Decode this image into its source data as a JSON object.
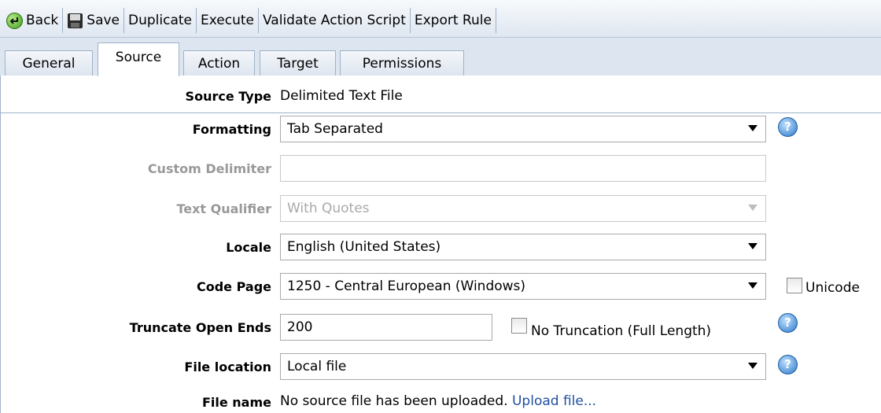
{
  "toolbar": {
    "back": "Back",
    "save": "Save",
    "duplicate": "Duplicate",
    "execute": "Execute",
    "validate": "Validate Action Script",
    "export": "Export Rule"
  },
  "tabs": {
    "general": "General",
    "source": "Source",
    "action": "Action",
    "target": "Target",
    "permissions": "Permissions",
    "active": "Source"
  },
  "form": {
    "source_type": {
      "label": "Source Type",
      "value": "Delimited Text File"
    },
    "formatting": {
      "label": "Formatting",
      "value": "Tab Separated"
    },
    "custom_delimiter": {
      "label": "Custom Delimiter",
      "value": ""
    },
    "text_qualifier": {
      "label": "Text Qualifier",
      "value": "With Quotes"
    },
    "locale": {
      "label": "Locale",
      "value": "English (United States)"
    },
    "code_page": {
      "label": "Code Page",
      "value": "1250 - Central European (Windows)",
      "unicode_label": "Unicode",
      "unicode_checked": false
    },
    "truncate": {
      "label": "Truncate Open Ends",
      "value": "200",
      "no_trunc_label": "No Truncation (Full Length)",
      "no_trunc_checked": false
    },
    "file_location": {
      "label": "File location",
      "value": "Local file"
    },
    "file_name": {
      "label": "File name",
      "value": "No source file has been uploaded.",
      "link": "Upload file..."
    }
  },
  "help_glyph": "?",
  "colors": {
    "accent": "#1f4fa0",
    "disabled": "#999999",
    "tab_border": "#9fb2c9"
  }
}
